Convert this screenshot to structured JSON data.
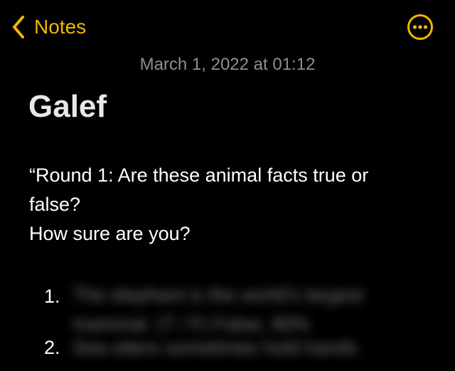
{
  "nav": {
    "back_label": "Notes"
  },
  "note": {
    "timestamp": "March 1, 2022 at 01:12",
    "title": "Galef",
    "body_line1": "“Round 1: Are these animal facts true or",
    "body_line2": "false?",
    "body_line3": "How sure are you?",
    "list": [
      {
        "number": "1.",
        "text": "The elephant is the world's largest mammal. (T / F) False, 90%"
      },
      {
        "number": "2.",
        "text": "Sea otters sometimes hold hands"
      }
    ]
  },
  "colors": {
    "accent": "#f2b700",
    "background": "#000000",
    "secondary_text": "#8e8e93"
  },
  "icons": {
    "back": "chevron-left-icon",
    "more": "ellipsis-circle-icon"
  }
}
